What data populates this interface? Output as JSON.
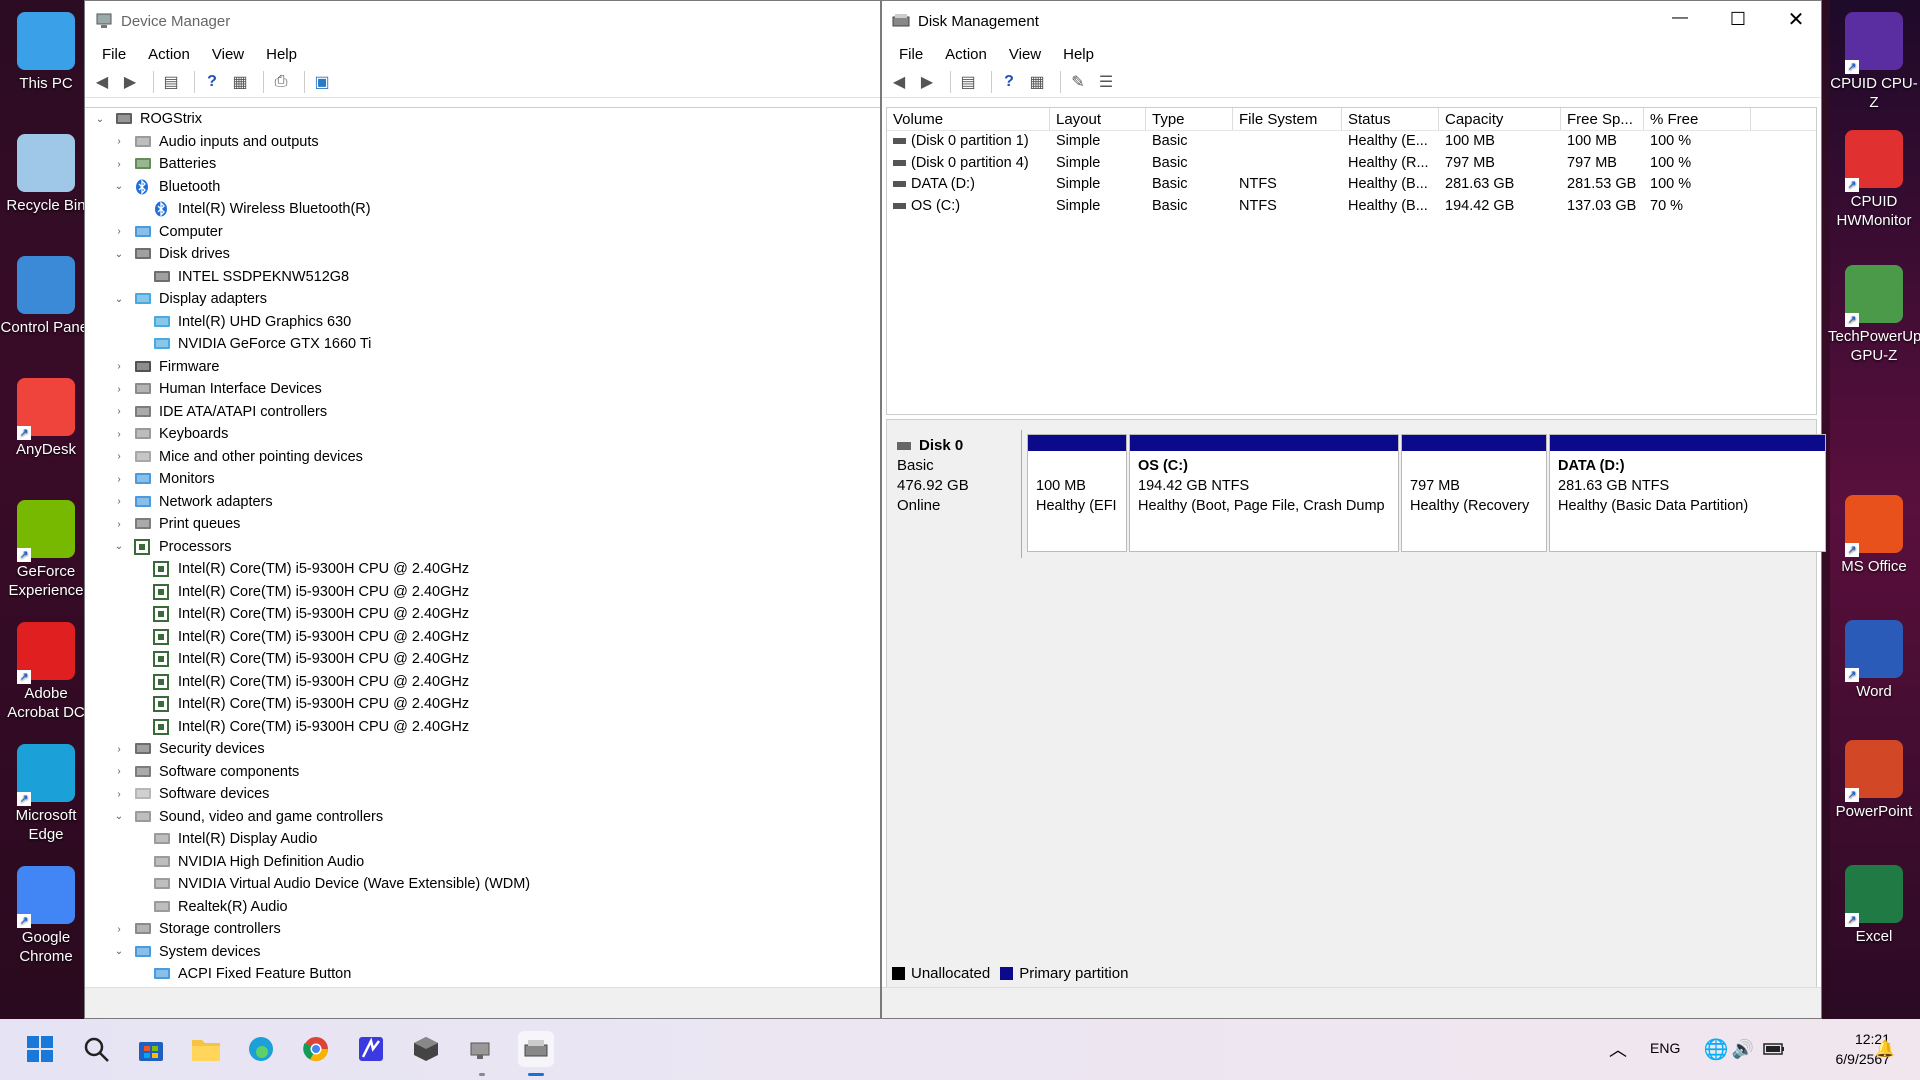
{
  "desktop": {
    "icons_left": [
      {
        "label": "This PC",
        "icon": "monitor-icon",
        "color": "#3aa0e8"
      },
      {
        "label": "Recycle Bin",
        "icon": "recycle-bin-icon",
        "color": "#9fc8e8"
      },
      {
        "label": "Control Panel",
        "icon": "control-panel-icon",
        "color": "#3a8ad8"
      },
      {
        "label": "AnyDesk",
        "icon": "anydesk-icon",
        "color": "#ef443b"
      },
      {
        "label": "GeForce Experience",
        "icon": "geforce-icon",
        "color": "#76b900"
      },
      {
        "label": "Adobe Acrobat DC",
        "icon": "acrobat-icon",
        "color": "#e02020"
      },
      {
        "label": "Microsoft Edge",
        "icon": "edge-icon",
        "color": "#1ba0d8"
      },
      {
        "label": "Google Chrome",
        "icon": "chrome-icon",
        "color": "#4285f4"
      }
    ],
    "icons_right": [
      {
        "label": "CPUID CPU-Z",
        "icon": "cpuz-icon",
        "color": "#5a2ea0"
      },
      {
        "label": "CPUID HWMonitor",
        "icon": "hwmonitor-icon",
        "color": "#e03030"
      },
      {
        "label": "TechPowerUp GPU-Z",
        "icon": "gpuz-icon",
        "color": "#4a9a4a"
      },
      {
        "label": "MS Office",
        "icon": "office-icon",
        "color": "#e8501c"
      },
      {
        "label": "Word",
        "icon": "word-icon",
        "color": "#2b5bb8"
      },
      {
        "label": "PowerPoint",
        "icon": "powerpoint-icon",
        "color": "#d24726"
      },
      {
        "label": "Excel",
        "icon": "excel-icon",
        "color": "#1f7a43"
      }
    ]
  },
  "device_manager": {
    "title": "Device Manager",
    "menu": [
      "File",
      "Action",
      "View",
      "Help"
    ],
    "tree": [
      {
        "label": "ROGStrix",
        "level": 0,
        "expanded": true,
        "icon": "computer-icon"
      },
      {
        "label": "Audio inputs and outputs",
        "level": 1,
        "expanded": false,
        "icon": "speaker-icon"
      },
      {
        "label": "Batteries",
        "level": 1,
        "expanded": false,
        "icon": "battery-icon"
      },
      {
        "label": "Bluetooth",
        "level": 1,
        "expanded": true,
        "icon": "bluetooth-icon"
      },
      {
        "label": "Intel(R) Wireless Bluetooth(R)",
        "level": 2,
        "icon": "bluetooth-icon"
      },
      {
        "label": "Computer",
        "level": 1,
        "expanded": false,
        "icon": "monitor-icon"
      },
      {
        "label": "Disk drives",
        "level": 1,
        "expanded": true,
        "icon": "disk-icon"
      },
      {
        "label": "INTEL SSDPEKNW512G8",
        "level": 2,
        "icon": "disk-icon"
      },
      {
        "label": "Display adapters",
        "level": 1,
        "expanded": true,
        "icon": "display-icon"
      },
      {
        "label": "Intel(R) UHD Graphics 630",
        "level": 2,
        "icon": "display-icon"
      },
      {
        "label": "NVIDIA GeForce GTX 1660 Ti",
        "level": 2,
        "icon": "display-icon"
      },
      {
        "label": "Firmware",
        "level": 1,
        "expanded": false,
        "icon": "chip-icon"
      },
      {
        "label": "Human Interface Devices",
        "level": 1,
        "expanded": false,
        "icon": "hid-icon"
      },
      {
        "label": "IDE ATA/ATAPI controllers",
        "level": 1,
        "expanded": false,
        "icon": "ide-icon"
      },
      {
        "label": "Keyboards",
        "level": 1,
        "expanded": false,
        "icon": "keyboard-icon"
      },
      {
        "label": "Mice and other pointing devices",
        "level": 1,
        "expanded": false,
        "icon": "mouse-icon"
      },
      {
        "label": "Monitors",
        "level": 1,
        "expanded": false,
        "icon": "monitor-icon"
      },
      {
        "label": "Network adapters",
        "level": 1,
        "expanded": false,
        "icon": "network-icon"
      },
      {
        "label": "Print queues",
        "level": 1,
        "expanded": false,
        "icon": "printer-icon"
      },
      {
        "label": "Processors",
        "level": 1,
        "expanded": true,
        "icon": "processor-icon"
      },
      {
        "label": "Intel(R) Core(TM) i5-9300H CPU @ 2.40GHz",
        "level": 2,
        "icon": "processor-icon"
      },
      {
        "label": "Intel(R) Core(TM) i5-9300H CPU @ 2.40GHz",
        "level": 2,
        "icon": "processor-icon"
      },
      {
        "label": "Intel(R) Core(TM) i5-9300H CPU @ 2.40GHz",
        "level": 2,
        "icon": "processor-icon"
      },
      {
        "label": "Intel(R) Core(TM) i5-9300H CPU @ 2.40GHz",
        "level": 2,
        "icon": "processor-icon"
      },
      {
        "label": "Intel(R) Core(TM) i5-9300H CPU @ 2.40GHz",
        "level": 2,
        "icon": "processor-icon"
      },
      {
        "label": "Intel(R) Core(TM) i5-9300H CPU @ 2.40GHz",
        "level": 2,
        "icon": "processor-icon"
      },
      {
        "label": "Intel(R) Core(TM) i5-9300H CPU @ 2.40GHz",
        "level": 2,
        "icon": "processor-icon"
      },
      {
        "label": "Intel(R) Core(TM) i5-9300H CPU @ 2.40GHz",
        "level": 2,
        "icon": "processor-icon"
      },
      {
        "label": "Security devices",
        "level": 1,
        "expanded": false,
        "icon": "security-icon"
      },
      {
        "label": "Software components",
        "level": 1,
        "expanded": false,
        "icon": "component-icon"
      },
      {
        "label": "Software devices",
        "level": 1,
        "expanded": false,
        "icon": "software-device-icon"
      },
      {
        "label": "Sound, video and game controllers",
        "level": 1,
        "expanded": true,
        "icon": "speaker-icon"
      },
      {
        "label": "Intel(R) Display Audio",
        "level": 2,
        "icon": "speaker-icon"
      },
      {
        "label": "NVIDIA High Definition Audio",
        "level": 2,
        "icon": "speaker-icon"
      },
      {
        "label": "NVIDIA Virtual Audio Device (Wave Extensible) (WDM)",
        "level": 2,
        "icon": "speaker-icon"
      },
      {
        "label": "Realtek(R) Audio",
        "level": 2,
        "icon": "speaker-icon"
      },
      {
        "label": "Storage controllers",
        "level": 1,
        "expanded": false,
        "icon": "storage-icon"
      },
      {
        "label": "System devices",
        "level": 1,
        "expanded": true,
        "icon": "system-icon"
      },
      {
        "label": "ACPI Fixed Feature Button",
        "level": 2,
        "icon": "system-icon"
      }
    ]
  },
  "disk_management": {
    "title": "Disk Management",
    "menu": [
      "File",
      "Action",
      "View",
      "Help"
    ],
    "columns": [
      "Volume",
      "Layout",
      "Type",
      "File System",
      "Status",
      "Capacity",
      "Free Sp...",
      "% Free"
    ],
    "rows": [
      [
        "(Disk 0 partition 1)",
        "Simple",
        "Basic",
        "",
        "Healthy (E...",
        "100 MB",
        "100 MB",
        "100 %"
      ],
      [
        "(Disk 0 partition 4)",
        "Simple",
        "Basic",
        "",
        "Healthy (R...",
        "797 MB",
        "797 MB",
        "100 %"
      ],
      [
        "DATA (D:)",
        "Simple",
        "Basic",
        "NTFS",
        "Healthy (B...",
        "281.63 GB",
        "281.53 GB",
        "100 %"
      ],
      [
        "OS (C:)",
        "Simple",
        "Basic",
        "NTFS",
        "Healthy (B...",
        "194.42 GB",
        "137.03 GB",
        "70 %"
      ]
    ],
    "disk": {
      "name": "Disk 0",
      "type": "Basic",
      "size": "476.92 GB",
      "state": "Online"
    },
    "partitions": [
      {
        "name": "",
        "line1": "100 MB",
        "line2": "Healthy (EFI"
      },
      {
        "name": "OS  (C:)",
        "line1": "194.42 GB NTFS",
        "line2": "Healthy (Boot, Page File, Crash Dump"
      },
      {
        "name": "",
        "line1": "797 MB",
        "line2": "Healthy (Recovery"
      },
      {
        "name": "DATA  (D:)",
        "line1": "281.63 GB NTFS",
        "line2": "Healthy (Basic Data Partition)"
      }
    ],
    "legend": [
      {
        "label": "Unallocated",
        "color": "#000000"
      },
      {
        "label": "Primary partition",
        "color": "#0a0a8a"
      }
    ]
  },
  "taskbar": {
    "lang": "ENG",
    "time": "12:21",
    "date": "6/9/2567"
  }
}
